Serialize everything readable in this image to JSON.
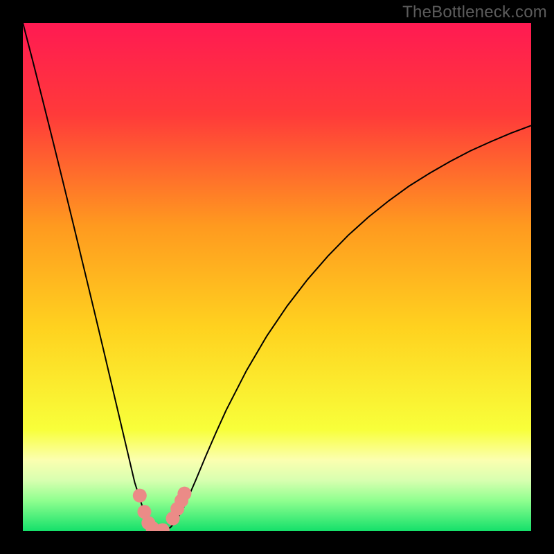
{
  "watermark": "TheBottleneck.com",
  "chart_data": {
    "type": "line",
    "title": "",
    "xlabel": "",
    "ylabel": "",
    "xlim": [
      0,
      100
    ],
    "ylim": [
      0,
      100
    ],
    "x": [
      0,
      2,
      4,
      6,
      8,
      10,
      12,
      14,
      16,
      18,
      20,
      22,
      24,
      25,
      26,
      27,
      28,
      29,
      30,
      31,
      32,
      34,
      36,
      38,
      40,
      44,
      48,
      52,
      56,
      60,
      64,
      68,
      72,
      76,
      80,
      84,
      88,
      92,
      96,
      100
    ],
    "values": [
      100,
      92.3,
      84.4,
      76.4,
      68.3,
      60.1,
      51.8,
      43.5,
      35.1,
      26.6,
      18.1,
      9.6,
      3.3,
      1.4,
      0.5,
      0.2,
      0.2,
      0.7,
      1.8,
      3.5,
      5.4,
      10.0,
      14.8,
      19.4,
      23.8,
      31.6,
      38.4,
      44.3,
      49.5,
      54.1,
      58.2,
      61.8,
      65.0,
      67.9,
      70.4,
      72.7,
      74.8,
      76.6,
      78.3,
      79.8
    ],
    "marker_points_x": [
      23.0,
      23.9,
      24.7,
      25.5,
      27.5,
      29.5,
      30.4,
      31.2,
      31.8
    ],
    "marker_points_y": [
      7.0,
      3.8,
      1.6,
      0.6,
      0.2,
      2.5,
      4.4,
      6.0,
      7.4
    ],
    "gradient_stops": [
      {
        "offset": 0,
        "color": "#ff1a52"
      },
      {
        "offset": 18,
        "color": "#ff3a3a"
      },
      {
        "offset": 40,
        "color": "#ff9a1f"
      },
      {
        "offset": 60,
        "color": "#ffd21f"
      },
      {
        "offset": 80,
        "color": "#f8ff3a"
      },
      {
        "offset": 86,
        "color": "#fbffb0"
      },
      {
        "offset": 90,
        "color": "#d8ffb0"
      },
      {
        "offset": 94,
        "color": "#8fff8f"
      },
      {
        "offset": 100,
        "color": "#14e06a"
      }
    ],
    "marker_color": "#eb8b87",
    "curve_color": "#000000"
  }
}
